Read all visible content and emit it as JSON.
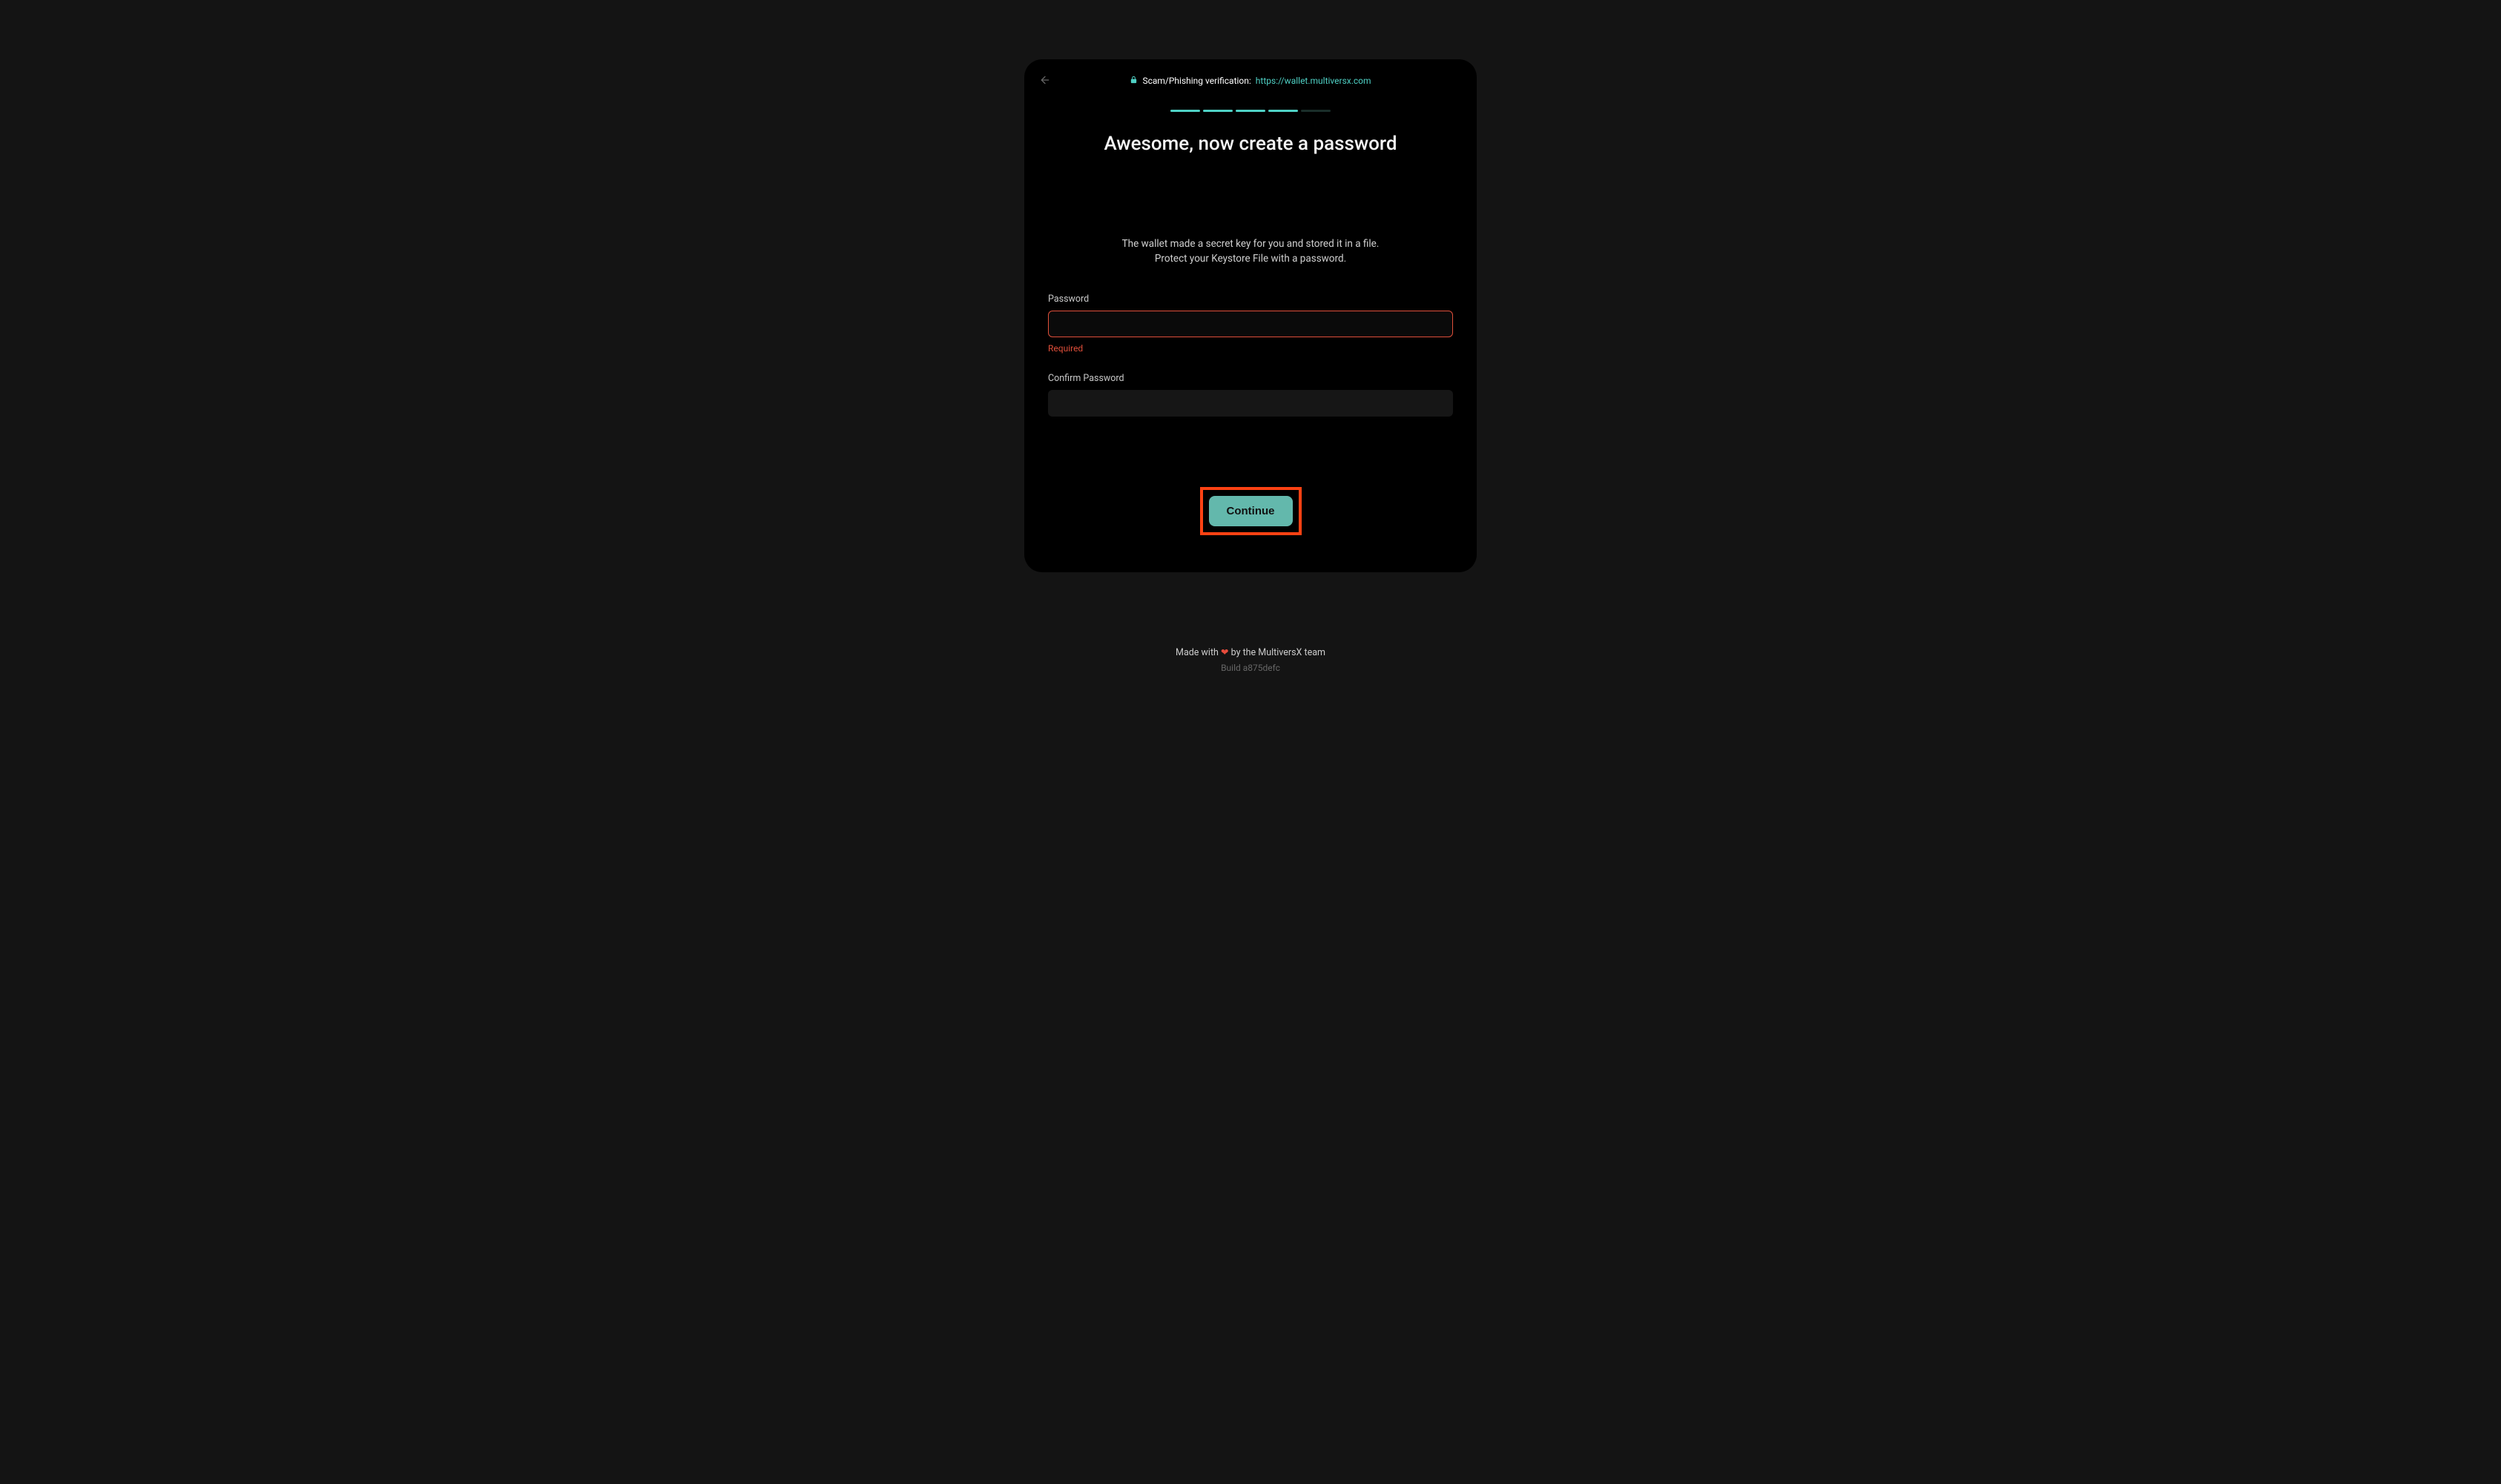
{
  "verification": {
    "label": "Scam/Phishing verification:",
    "url": "https://wallet.multiversx.com"
  },
  "title": "Awesome, now create a password",
  "description_line1": "The wallet made a secret key for you and stored it in a file.",
  "description_line2": "Protect your Keystore File with a password.",
  "form": {
    "password_label": "Password",
    "password_error": "Required",
    "confirm_label": "Confirm Password"
  },
  "continue_label": "Continue",
  "footer": {
    "line1_prefix": "Made with ",
    "line1_suffix": " by the MultiversX team",
    "heart": "❤",
    "build": "Build a875defc"
  }
}
